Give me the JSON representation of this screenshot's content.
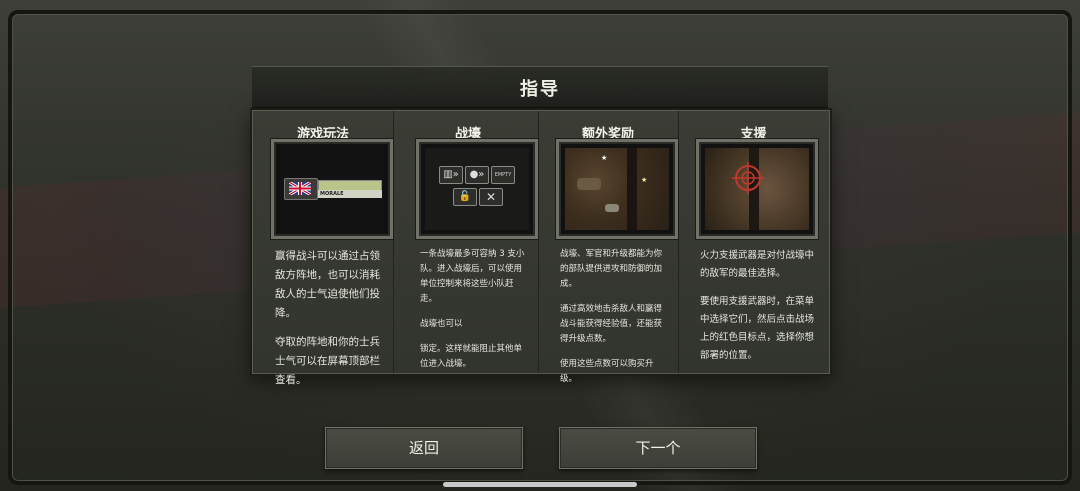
{
  "title": "指导",
  "columns": [
    {
      "heading": "游戏玩法",
      "morale_label": "MORALE",
      "paragraphs": [
        "赢得战斗可以通过占领敌方阵地，也可以消耗敌人的士气迫使他们投降。",
        "夺取的阵地和你的士兵士气可以在屏幕顶部栏查看。"
      ]
    },
    {
      "heading": "战壕",
      "slot_empty_label": "EMPTY",
      "paragraphs": [
        "一条战壕最多可容纳 3 支小队。进入战壕后，可以使用单位控制来将这些小队赶走。",
        "战壕也可以",
        "锁定。这样就能阻止其他单位进入战壕。"
      ]
    },
    {
      "heading": "额外奖励",
      "paragraphs": [
        "战壕、军官和升级都能为你的部队提供进攻和防御的加成。",
        "通过高效地击杀敌人和赢得战斗能获得经验值，还能获得升级点数。",
        "使用这些点数可以购买升级。"
      ]
    },
    {
      "heading": "支援",
      "paragraphs": [
        "火力支援武器是对付战壕中的敌军的最佳选择。",
        "要使用支援武器时，在菜单中选择它们，然后点击战场上的红色目标点，选择你想部署的位置。"
      ]
    }
  ],
  "buttons": {
    "back": "返回",
    "next": "下一个"
  },
  "colors": {
    "panel": "#35372f",
    "morale_bar": "#b8c48a",
    "target_red": "#c0392b"
  }
}
